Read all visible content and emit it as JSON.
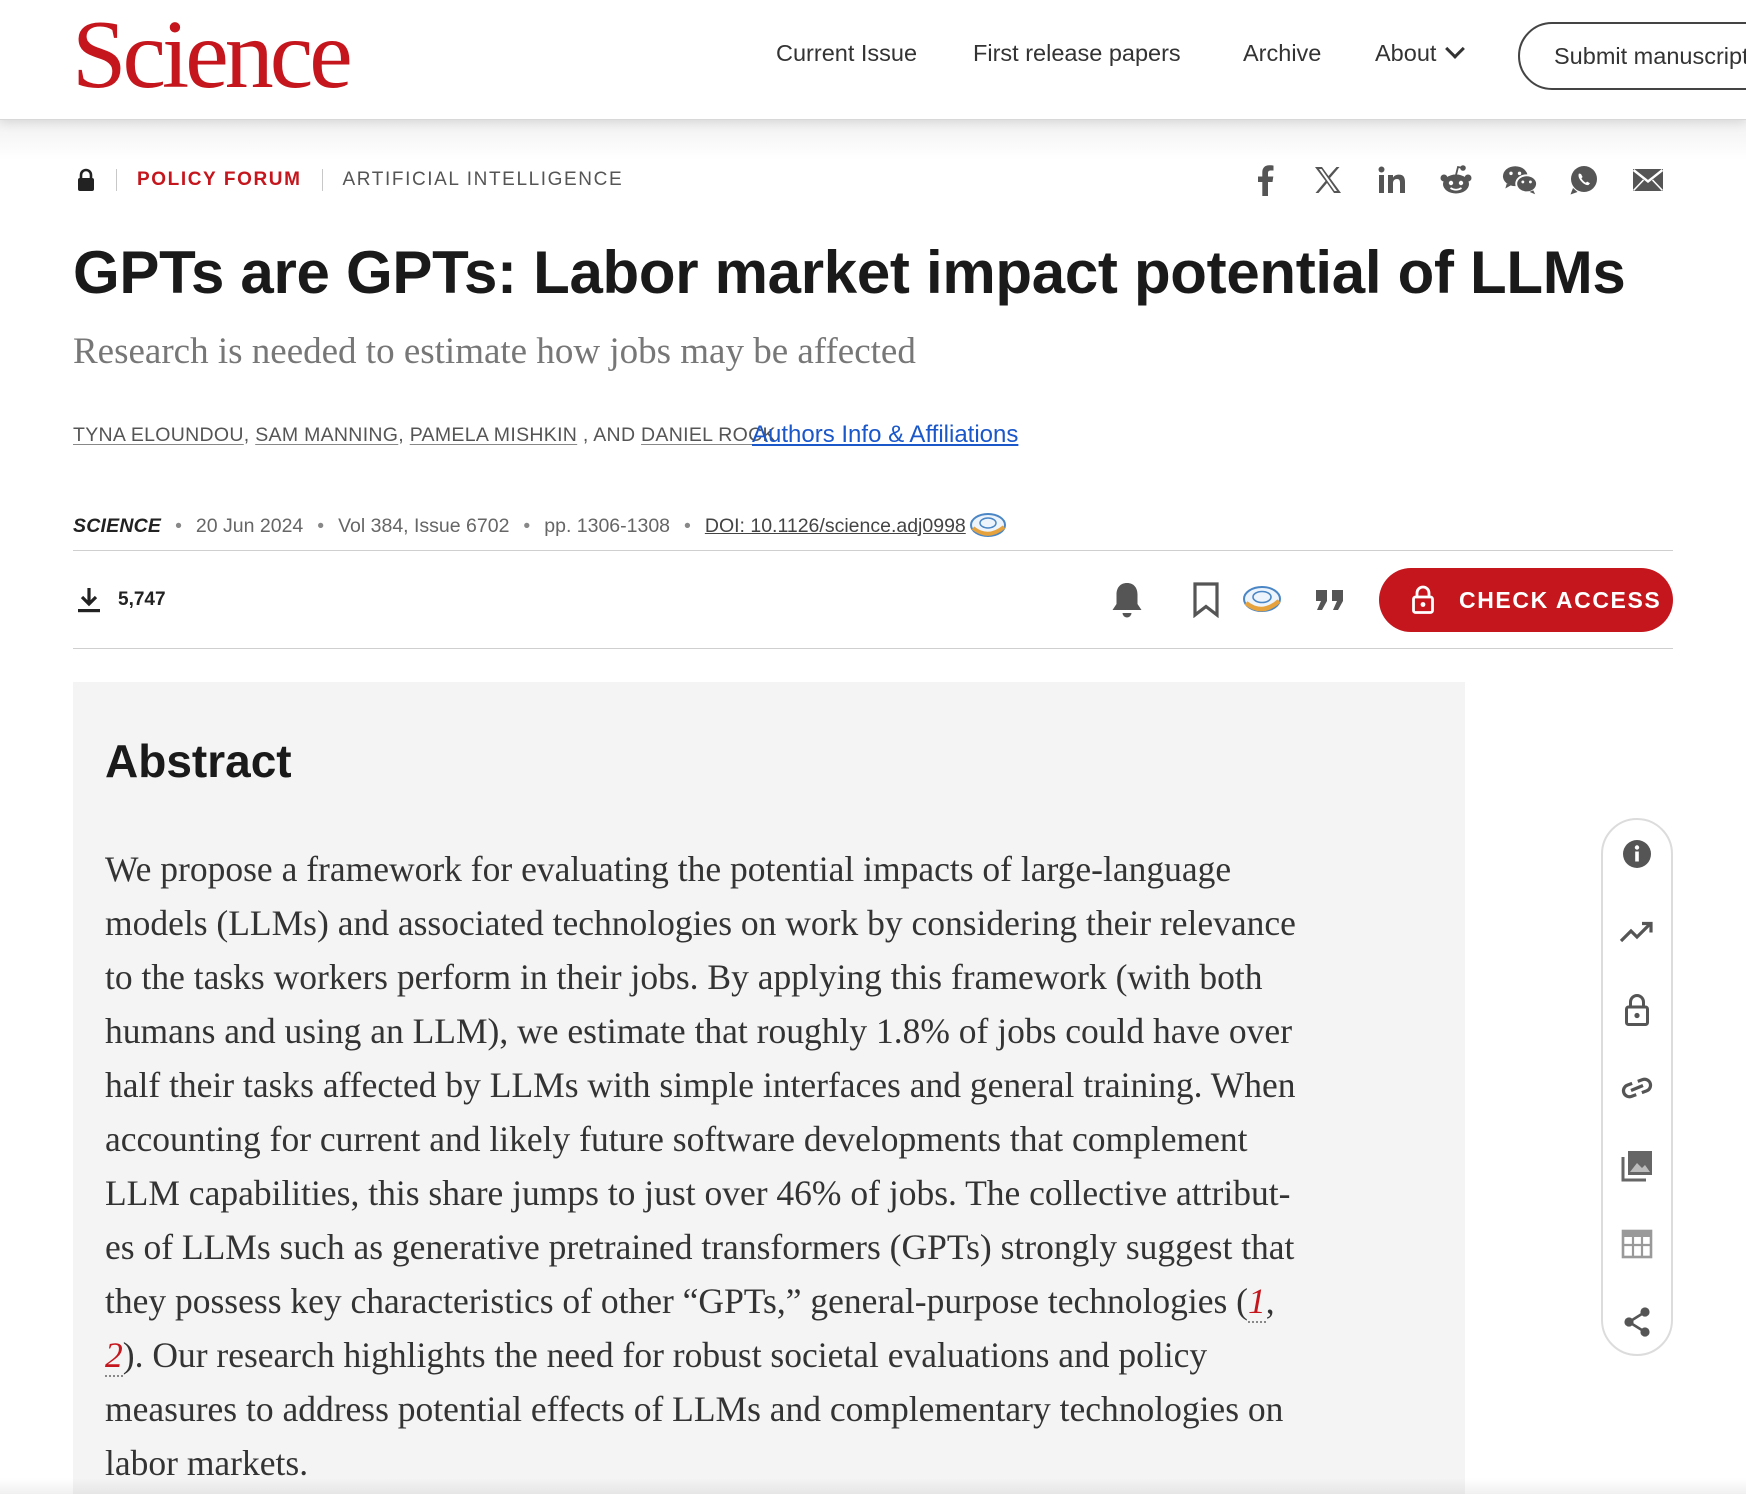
{
  "header": {
    "logo": "Science",
    "nav": [
      "Current Issue",
      "First release papers",
      "Archive",
      "About"
    ],
    "submit": "Submit manuscript"
  },
  "breadcrumb": {
    "section": "POLICY FORUM",
    "topic": "ARTIFICIAL INTELLIGENCE"
  },
  "share": [
    "facebook-icon",
    "x-icon",
    "linkedin-icon",
    "reddit-icon",
    "wechat-icon",
    "whatsapp-icon",
    "email-icon"
  ],
  "article": {
    "title": "GPTs are GPTs: Labor market impact potential of LLMs",
    "subtitle": "Research is needed to estimate how jobs may be affected",
    "authors": [
      "TYNA ELOUNDOU",
      "SAM MANNING",
      "PAMELA MISHKIN",
      "DANIEL ROCK"
    ],
    "authors_joiners": [
      ", ",
      ", ",
      " , AND "
    ],
    "affiliations_link": "Authors Info & Affiliations"
  },
  "citation": {
    "journal": "SCIENCE",
    "date": "20 Jun 2024",
    "volume": "Vol 384, Issue 6702",
    "pages": "pp. 1306-1308",
    "doi": "DOI: 10.1126/science.adj0998"
  },
  "metrics": {
    "downloads": "5,747"
  },
  "actions": {
    "check_access": "CHECK ACCESS"
  },
  "abstract": {
    "heading": "Abstract",
    "lines": [
      "We propose a framework for evaluating the potential impacts of large-language",
      "models (LLMs) and associated technologies on work by considering their relevance",
      "to the tasks workers perform in their jobs. By applying this framework (with both",
      "humans and using an LLM), we estimate that roughly 1.8% of jobs could have over",
      "half their tasks affected by LLMs with simple interfaces and general training. When",
      "accounting for current and likely future software developments that complement",
      "LLM capabilities, this share jumps to just over 46% of jobs. The collective attribut-",
      "es of LLMs such as generative pretrained transformers (GPTs) strongly suggest that"
    ],
    "line9_pre": "they possess key characteristics of other “GPTs,” general-purpose technologies (",
    "ref1": "1",
    "line9_post": ",",
    "ref2": "2",
    "line10_post": "). Our research highlights the need for robust societal evaluations and policy",
    "line11": "measures to address potential effects of LLMs and complementary technologies on",
    "line12": "labor markets."
  },
  "rail": [
    "info-icon",
    "trending-icon",
    "unlock-icon",
    "link-icon",
    "image-icon",
    "table-icon",
    "share-icon"
  ]
}
